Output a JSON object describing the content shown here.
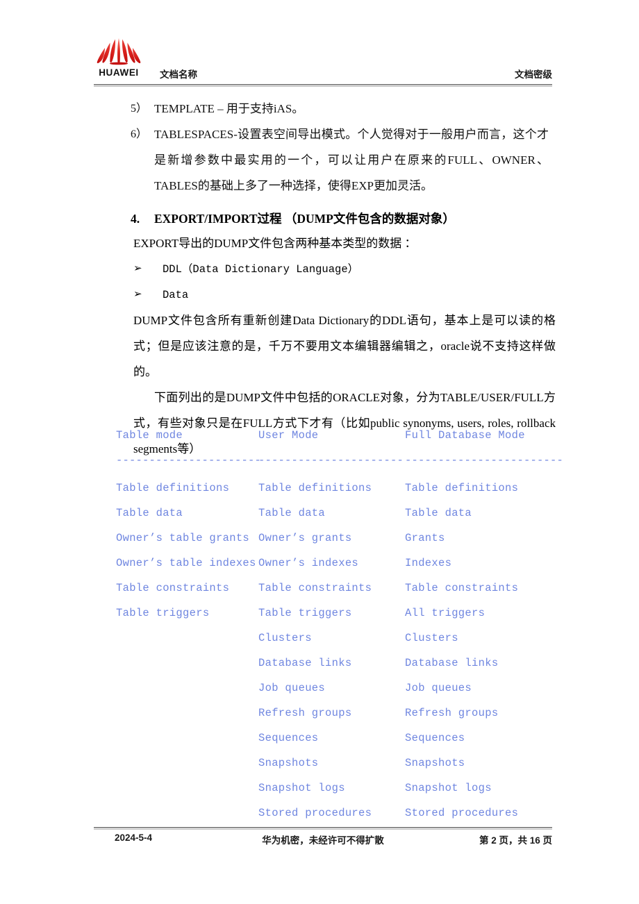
{
  "header": {
    "logo_text": "HUAWEI",
    "doc_name": "文档名称",
    "doc_level": "文档密级"
  },
  "body": {
    "item5_marker": "5）",
    "item5_text": "TEMPLATE – 用于支持iAS。",
    "item6_marker": "6）",
    "item6_text": "TABLESPACES-设置表空间导出模式。个人觉得对于一般用户而言，这个才是新增参数中最实用的一个，可以让用户在原来的FULL、OWNER、TABLES的基础上多了一种选择，使得EXP更加灵活。",
    "section4_marker": "4.",
    "section4_title": "EXPORT/IMPORT过程 （DUMP文件包含的数据对象）",
    "intro_line": "EXPORT导出的DUMP文件包含两种基本类型的数据 ：",
    "arrow_marker": "➢",
    "arrow_item1": "DDL（Data Dictionary Language）",
    "arrow_item2": "Data",
    "para1": "DUMP文件包含所有重新创建Data Dictionary的DDL语句，基本上是可以读的格式；但是应该注意的是，千万不要用文本编辑器编辑之，oracle说不支持这样做的。",
    "para2": "下面列出的是DUMP文件中包括的ORACLE对象，分为TABLE/USER/FULL方式，有些对象只是在FULL方式下才有（比如public synonyms, users, roles, rollback segments等）"
  },
  "modes_table": {
    "text_color": "#6f86e0",
    "headers": [
      "Table mode",
      "User Mode",
      "Full Database Mode"
    ],
    "rules": [
      "----------------------",
      "----------------------",
      "------------------------"
    ],
    "rows": [
      [
        "Table definitions",
        "Table definitions",
        "Table definitions"
      ],
      [
        "Table data",
        "Table data",
        "Table data"
      ],
      [
        "Owner’s table grants",
        "Owner’s grants",
        "Grants"
      ],
      [
        "Owner’s table indexes",
        "Owner’s indexes",
        "Indexes"
      ],
      [
        "Table constraints",
        "Table constraints",
        "Table constraints"
      ],
      [
        "Table triggers",
        "Table triggers",
        "All triggers"
      ],
      [
        "",
        "Clusters",
        "Clusters"
      ],
      [
        "",
        "Database links",
        "Database links"
      ],
      [
        "",
        "Job queues",
        "Job queues"
      ],
      [
        "",
        "Refresh groups",
        "Refresh groups"
      ],
      [
        "",
        "Sequences",
        "Sequences"
      ],
      [
        "",
        "Snapshots",
        "Snapshots"
      ],
      [
        "",
        "Snapshot logs",
        "Snapshot logs"
      ],
      [
        "",
        "Stored procedures",
        "Stored procedures"
      ]
    ]
  },
  "footer": {
    "date": "2024-5-4",
    "confidential": "华为机密，未经许可不得扩散",
    "pages": "第 2 页，共 16 页"
  }
}
